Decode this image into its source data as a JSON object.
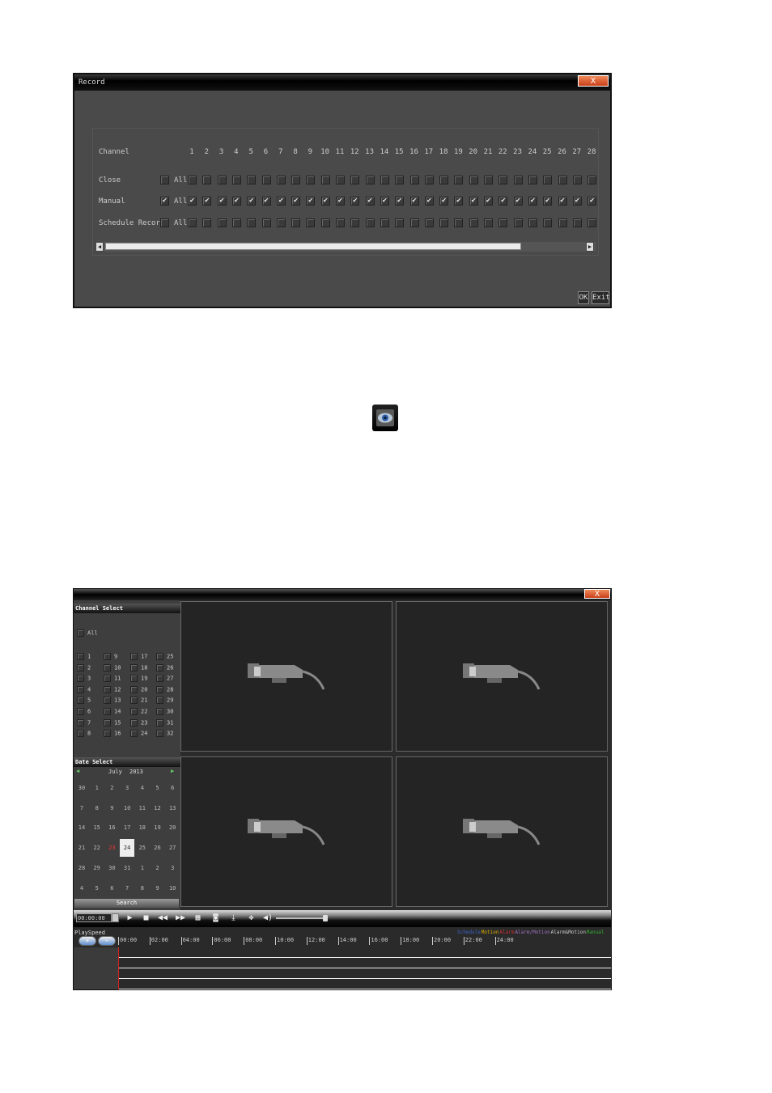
{
  "record_window": {
    "title": "Record",
    "close_label": "X",
    "row_labels": {
      "channel": "Channel",
      "close": "Close",
      "manual": "Manual",
      "schedule": "Schedule Record"
    },
    "all_label": "All",
    "channels": [
      "1",
      "2",
      "3",
      "4",
      "5",
      "6",
      "7",
      "8",
      "9",
      "10",
      "11",
      "12",
      "13",
      "14",
      "15",
      "16",
      "17",
      "18",
      "19",
      "20",
      "21",
      "22",
      "23",
      "24",
      "25",
      "26",
      "27",
      "28"
    ],
    "manual_checked": true,
    "ok_label": "OK",
    "exit_label": "Exit"
  },
  "playback_window": {
    "close_label": "X",
    "channel_select": {
      "heading": "Channel Select",
      "all_label": "All",
      "channels": [
        "1",
        "9",
        "17",
        "25",
        "2",
        "10",
        "18",
        "26",
        "3",
        "11",
        "19",
        "27",
        "4",
        "12",
        "20",
        "28",
        "5",
        "13",
        "21",
        "29",
        "6",
        "14",
        "22",
        "30",
        "7",
        "15",
        "23",
        "31",
        "8",
        "16",
        "24",
        "32"
      ]
    },
    "date_select": {
      "heading": "Date Select",
      "month": "July",
      "year": "2013",
      "days": [
        "30",
        "1",
        "2",
        "3",
        "4",
        "5",
        "6",
        "7",
        "8",
        "9",
        "10",
        "11",
        "12",
        "13",
        "14",
        "15",
        "16",
        "17",
        "18",
        "19",
        "20",
        "21",
        "22",
        "23",
        "24",
        "25",
        "26",
        "27",
        "28",
        "29",
        "30",
        "31",
        "1",
        "2",
        "3",
        "4",
        "5",
        "6",
        "7",
        "8",
        "9",
        "10"
      ],
      "selected_day": "24",
      "today_day": "23",
      "search_label": "Search"
    },
    "controls": {
      "time": "00:00:00"
    },
    "timeline": {
      "playspeed_label": "PlaySpeed",
      "ticks": [
        "00:00",
        "02:00",
        "04:00",
        "06:00",
        "08:00",
        "10:00",
        "12:00",
        "14:00",
        "16:00",
        "18:00",
        "20:00",
        "22:00",
        "24:00"
      ],
      "legend": [
        {
          "text": "Schedule",
          "color": "#3a63c8"
        },
        {
          "text": "Motion",
          "color": "#e0b000"
        },
        {
          "text": "Alarm",
          "color": "#d03030"
        },
        {
          "text": "Alarm/Motion",
          "color": "#a070c0"
        },
        {
          "text": "Alarm&Motion",
          "color": "#cccccc"
        },
        {
          "text": "Manual",
          "color": "#30b030"
        }
      ]
    }
  }
}
